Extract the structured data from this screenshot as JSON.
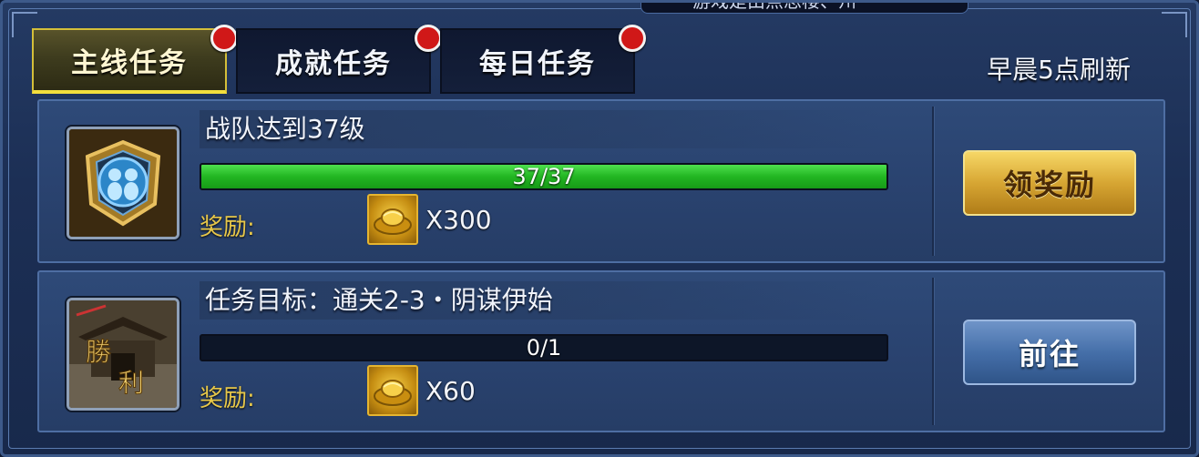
{
  "header": {
    "banner_text": "游戏是由点思楼、州",
    "refresh_note": "早晨5点刷新"
  },
  "tabs": [
    {
      "label": "主线任务",
      "active": true,
      "has_alert": true
    },
    {
      "label": "成就任务",
      "active": false,
      "has_alert": true
    },
    {
      "label": "每日任务",
      "active": false,
      "has_alert": true
    }
  ],
  "quests": [
    {
      "title": "战队达到37级",
      "progress_text": "37/37",
      "progress_fraction": 1.0,
      "reward_label": "奖励:",
      "reward_amount": "X300",
      "reward_icon": "gold-ingot-icon",
      "action_label": "领奖励",
      "action_style": "gold",
      "icon": "team-level-emblem-icon"
    },
    {
      "title": "任务目标：通关2-3・阴谋伊始",
      "progress_text": "0/1",
      "progress_fraction": 0.0,
      "reward_label": "奖励:",
      "reward_amount": "X60",
      "reward_icon": "gold-ingot-icon",
      "action_label": "前往",
      "action_style": "blue",
      "icon": "victory-stage-icon"
    }
  ],
  "colors": {
    "active_tab_border": "#d4bf3a",
    "alert_dot": "#d01818",
    "progress_fill": "#22b622",
    "reward_label": "#e8c84a"
  }
}
